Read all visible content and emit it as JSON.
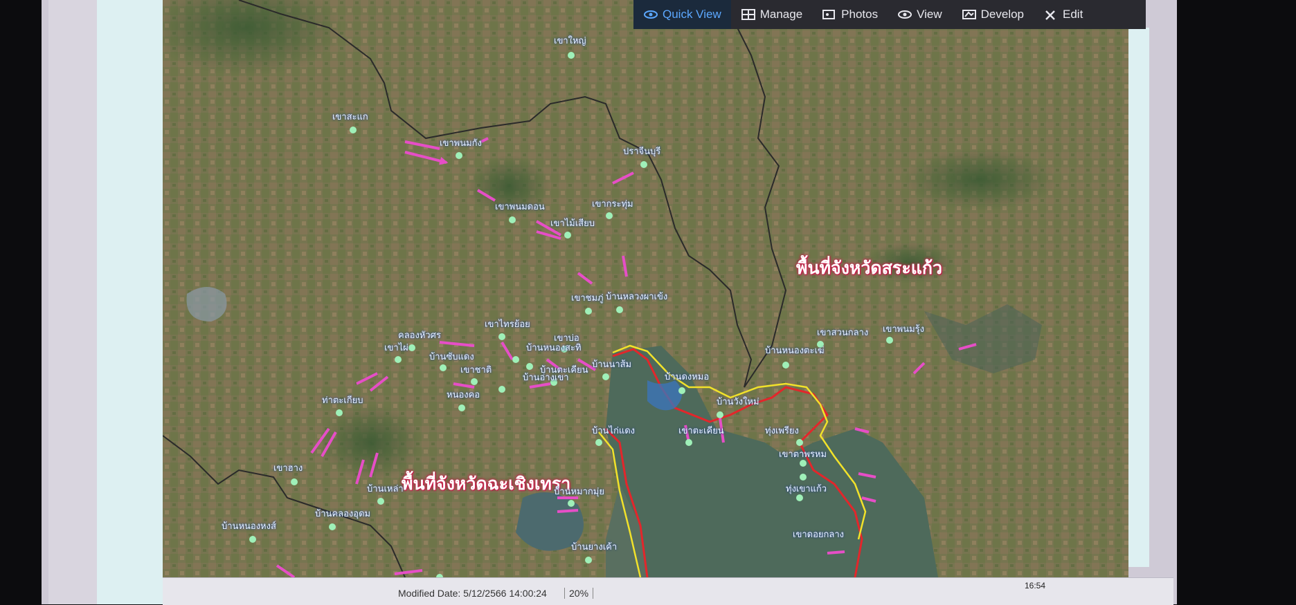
{
  "toolbar": {
    "items": [
      {
        "label": "Quick View",
        "icon": "eye-icon",
        "active": true
      },
      {
        "label": "Manage",
        "icon": "grid-icon"
      },
      {
        "label": "Photos",
        "icon": "photos-icon"
      },
      {
        "label": "View",
        "icon": "eye-icon"
      },
      {
        "label": "Develop",
        "icon": "develop-icon"
      },
      {
        "label": "Edit",
        "icon": "edit-icon"
      }
    ],
    "accent": "#5ca8ff"
  },
  "map": {
    "provinces": [
      {
        "label": "พื้นที่จังหวัดสระแก้ว"
      },
      {
        "label": "พื้นที่จังหวัดฉะเชิงเทรา"
      }
    ],
    "places": [
      "เขาใหญ่",
      "เขาสะแก",
      "เขาพนมกัง",
      "ปราจีนบุรี",
      "เขาพนมดอน",
      "เขาไม้เสียบ",
      "เขากระทุ่ม",
      "เขาชมภู่",
      "บ้านหลวงผาเข้ง",
      "เขาไทรย้อย",
      "บ้านหนองสะทิ",
      "บ้านซับแดง",
      "เขาไผ่",
      "คลองหัวศร",
      "เขาชาติ",
      "บ้านอ่างเขา",
      "หนองคอ",
      "ท่าตะเกียบ",
      "บ้านตะเคียน",
      "เขาบ่อ",
      "บ้านนาส้ม",
      "บ้านไก่แดง",
      "เขาฮาง",
      "บ้านเหล่า",
      "บ้านคลองอุดม",
      "บ้านหนองหงส์",
      "บ้านหมากมุ่ย",
      "บ้านยางเค้า",
      "บ้านหนองตะเฆ่",
      "เขาสวนกลาง",
      "เขาพนมรุ้ง",
      "ทุ่งเพรียง",
      "เขาตาพรหม",
      "ทุ่งเขาแก้ว",
      "เขาดอยกลาง",
      "บ้านดงหมอ",
      "บ้านวังใหม่",
      "เขาตะเคียน"
    ],
    "colors": {
      "boundary_outer": "#e3262b",
      "boundary_inner": "#f2e22a",
      "arrow": "#e64ec7",
      "point": "#9ff0b8",
      "province_label_glow": "#d01c4e"
    }
  },
  "statusbar": {
    "meta": "Modified Date: 5/12/2566 14:00:24",
    "zoom": "20%",
    "time": "16:54"
  }
}
